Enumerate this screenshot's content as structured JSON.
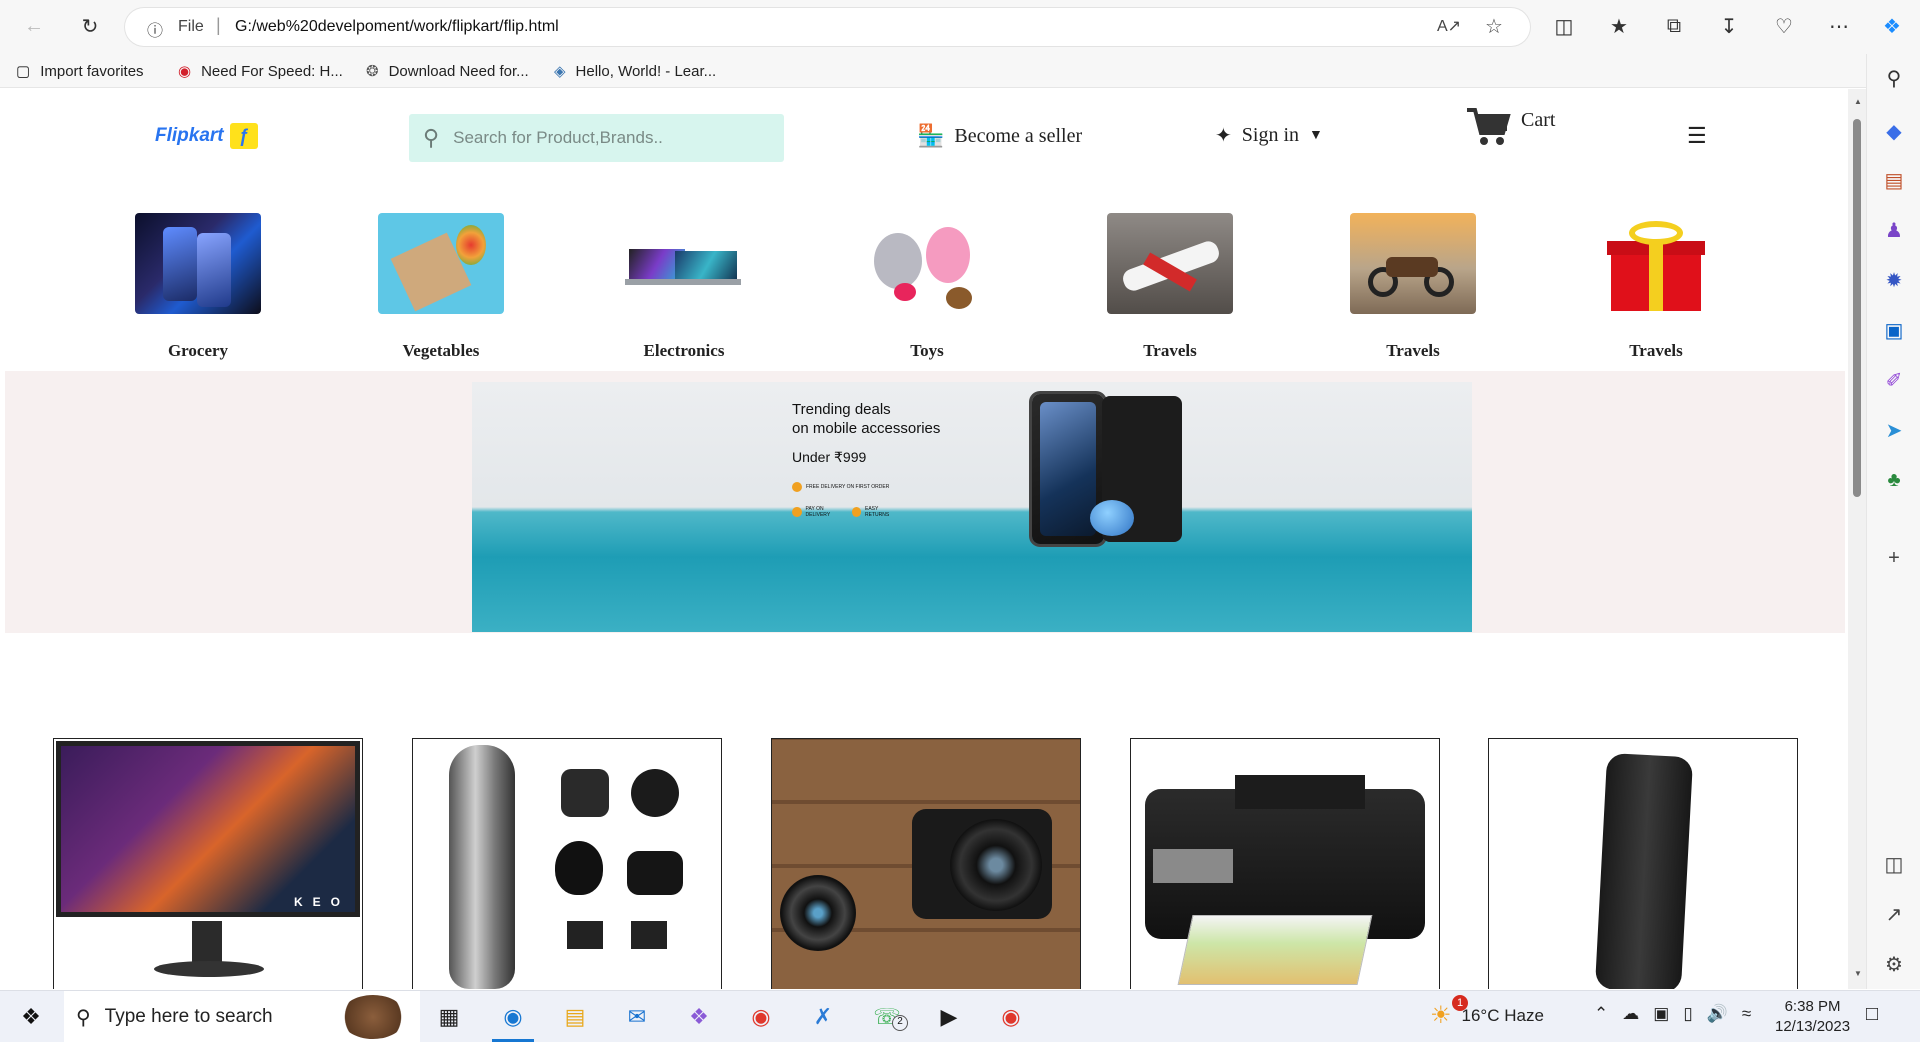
{
  "browser": {
    "address": {
      "scheme": "File",
      "url": "G:/web%20develpoment/work/flipkart/flip.html"
    },
    "favorites": [
      {
        "label": "Import favorites",
        "icon": "import-icon"
      },
      {
        "label": "Need For Speed: H...",
        "icon": "game-icon"
      },
      {
        "label": "Download Need for...",
        "icon": "download-site-icon"
      },
      {
        "label": "Hello, World! - Lear...",
        "icon": "python-icon"
      }
    ]
  },
  "header": {
    "logo_text": "Flipkart",
    "search_placeholder": "Search for Product,Brands..",
    "seller_label": "Become a seller",
    "signin_label": "Sign in",
    "cart_label": "Cart"
  },
  "categories": [
    {
      "label": "Grocery"
    },
    {
      "label": "Vegetables"
    },
    {
      "label": "Electronics"
    },
    {
      "label": "Toys"
    },
    {
      "label": "Travels"
    },
    {
      "label": "Travels"
    },
    {
      "label": "Travels"
    }
  ],
  "banner": {
    "line1": "Trending deals",
    "line2": "on mobile accessories",
    "price": "Under ₹999",
    "badges": [
      "FREE DELIVERY ON FIRST ORDER",
      "PAY ON DELIVERY",
      "EASY RETURNS"
    ]
  },
  "products": [
    {
      "name": "monitor"
    },
    {
      "name": "trimmer"
    },
    {
      "name": "camera"
    },
    {
      "name": "printer"
    },
    {
      "name": "power-bank"
    }
  ],
  "taskbar": {
    "search_placeholder": "Type here to search",
    "weather": "16°C  Haze",
    "weather_badge": "1",
    "whatsapp_badge": "2",
    "time": "6:38 PM",
    "date": "12/13/2023"
  },
  "colors": {
    "brand": "#2874f0",
    "logo_yellow": "#ffe11b",
    "search_bg": "#d7f5ee",
    "band": "#f7f0f0"
  }
}
